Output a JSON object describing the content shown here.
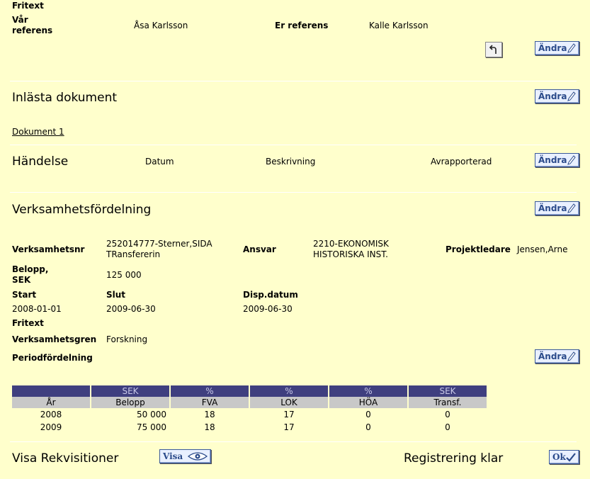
{
  "ref": {
    "fritext_label": "Fritext",
    "var_referens_label": "Vår\nreferens",
    "var_referens_value": "Åsa Karlsson",
    "er_referens_label": "Er referens",
    "er_referens_value": "Kalle Karlsson"
  },
  "buttons": {
    "andra": "Ändra",
    "visa": "Visa",
    "ok": "Ok"
  },
  "inlasta": {
    "title": "Inlästa dokument",
    "doc_link": "Dokument 1"
  },
  "handelse": {
    "title": "Händelse",
    "col_datum": "Datum",
    "col_beskrivning": "Beskrivning",
    "col_avrapporterad": "Avrapporterad"
  },
  "verksamhet": {
    "title": "Verksamhetsfördelning",
    "verksamhetsnr_label": "Verksamhetsnr",
    "verksamhetsnr_value": "252014777-Sterner,SIDA\nTRansfererin",
    "ansvar_label": "Ansvar",
    "ansvar_value": "2210-EKONOMISK\nHISTORISKA INST.",
    "projektledare_label": "Projektledare",
    "projektledare_value": "Jensen,Arne",
    "belopp_label": "Belopp,\nSEK",
    "belopp_value": "125 000",
    "start_label": "Start",
    "start_value": "2008-01-01",
    "slut_label": "Slut",
    "slut_value": "2009-06-30",
    "disp_label": "Disp.datum",
    "disp_value": "2009-06-30",
    "fritext_label": "Fritext",
    "gren_label": "Verksamhetsgren",
    "gren_value": "Forskning",
    "period_label": "Periodfördelning"
  },
  "period_table": {
    "units": [
      "",
      "SEK",
      "%",
      "%",
      "%",
      "SEK"
    ],
    "headers": [
      "År",
      "Belopp",
      "FVA",
      "LOK",
      "HÖA",
      "Transf."
    ],
    "rows": [
      [
        "2008",
        "50 000",
        "18",
        "17",
        "0",
        "0"
      ],
      [
        "2009",
        "75 000",
        "18",
        "17",
        "0",
        "0"
      ]
    ]
  },
  "footer": {
    "visa_rekv": "Visa Rekvisitioner",
    "reg_klar": "Registrering klar"
  }
}
